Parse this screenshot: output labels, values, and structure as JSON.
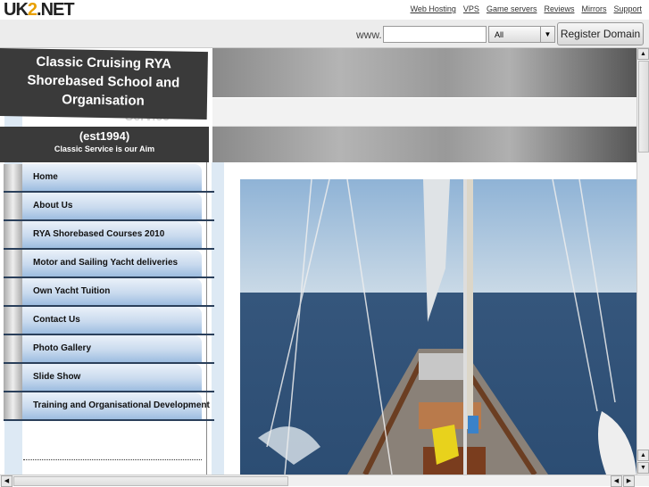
{
  "topbar": {
    "logo": "UK2.NET",
    "links": [
      "Web Hosting",
      "VPS",
      "Game servers",
      "Reviews",
      "Mirrors",
      "Support"
    ]
  },
  "search": {
    "prefix": "www.",
    "domain_value": "",
    "tld_selected": "All",
    "register_label": "Register Domain"
  },
  "header": {
    "title": "Classic Cruising RYA Shorebased School and Organisation",
    "ghost_text": "Service",
    "est": "(est1994)",
    "tagline": "Classic Service is our Aim"
  },
  "nav": {
    "items": [
      "Home",
      "About Us",
      "RYA Shorebased Courses 2010",
      "Motor and Sailing Yacht deliveries",
      "Own Yacht Tuition",
      "Contact Us",
      "Photo Gallery",
      "Slide Show",
      "Training and Organisational Development"
    ]
  },
  "colors": {
    "nav_blue": "#c9daee",
    "header_dark": "#3a3a3a",
    "sky": "#a9c6df",
    "sea": "#3c5f86"
  }
}
